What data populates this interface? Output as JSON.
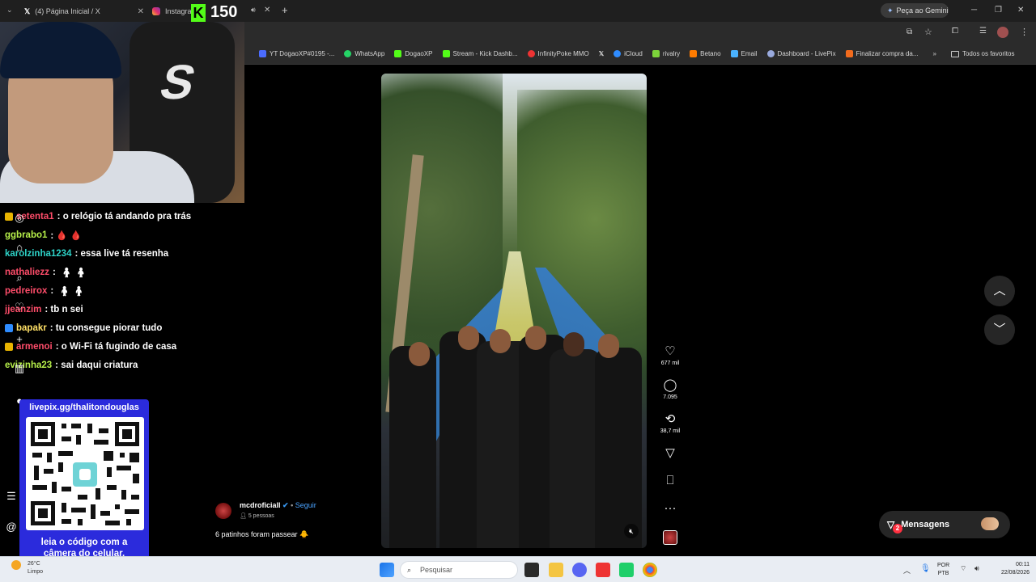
{
  "browser": {
    "tabs": [
      {
        "label": "(4) Página Inicial / X"
      },
      {
        "label": "Instagram"
      }
    ],
    "gemini_label": "Peça ao Gemini",
    "bookmarks": [
      {
        "label": "YT DogaoXP#0195 -...",
        "color": "#4b6cff"
      },
      {
        "label": "WhatsApp",
        "color": "#25d366"
      },
      {
        "label": "DogaoXP",
        "color": "#53fc18"
      },
      {
        "label": "Stream - Kick Dashb...",
        "color": "#53fc18"
      },
      {
        "label": "InfinityPoke MMO",
        "color": "#e33"
      },
      {
        "label": "",
        "color": "#888"
      },
      {
        "label": "iCloud",
        "color": "#2f8cff"
      },
      {
        "label": "rivalry",
        "color": "#7cd43a"
      },
      {
        "label": "Betano",
        "color": "#ff7b00"
      },
      {
        "label": "Email",
        "color": "#4ab3ff"
      },
      {
        "label": "Dashboard - LivePix",
        "color": "#9ad"
      },
      {
        "label": "Finalizar compra da...",
        "color": "#f26b1d"
      }
    ],
    "all_favorites": "Todos os favoritos"
  },
  "stream": {
    "viewer_count": "150",
    "chat": [
      {
        "user": "setenta1",
        "user_color": "#ff4d6a",
        "text": ": o relógio tá andando pra trás",
        "badge": "#e8b400"
      },
      {
        "user": "ggbrabo1",
        "user_color": "#b7f04a",
        "text": ": 🩸 🩸",
        "badge": ""
      },
      {
        "user": "karolzinha1234",
        "user_color": "#2ed3c8",
        "text": ": essa live tá resenha",
        "badge": ""
      },
      {
        "user": "nathaliezz",
        "user_color": "#ff4d6a",
        "text": ":",
        "badge": ""
      },
      {
        "user": "pedreirox",
        "user_color": "#ff4d6a",
        "text": ":",
        "badge": ""
      },
      {
        "user": "jjeanzim",
        "user_color": "#ff4d6a",
        "text": ": tb n sei",
        "badge": ""
      },
      {
        "user": "bapakr",
        "user_color": "#ffe066",
        "text": ": tu consegue piorar tudo",
        "badge": "#2e8cff"
      },
      {
        "user": "armenoi",
        "user_color": "#ff4d6a",
        "text": ": o Wi-Fi tá fugindo de casa",
        "badge": "#e8b400"
      },
      {
        "user": "evizinha23",
        "user_color": "#b7f04a",
        "text": ": sai daqui criatura",
        "badge": ""
      }
    ],
    "qr_url": "livepix.gg/thalitondouglas",
    "qr_caption_line1": "leia o código com a",
    "qr_caption_line2": "câmera do celular."
  },
  "reel": {
    "likes": "677 mil",
    "comments": "7.095",
    "reposts": "38,7 mil",
    "author": "mcdroficiall",
    "follow": "Seguir",
    "audience": "5 pessoas",
    "caption": "6 patinhos foram passear 🐥"
  },
  "messages": {
    "label": "Mensagens",
    "badge": "2"
  },
  "taskbar": {
    "weather_temp": "26°C",
    "weather_desc": "Limpo",
    "search_placeholder": "Pesquisar",
    "lang_top": "POR",
    "lang_bottom": "PTB",
    "time": "00:11",
    "date": "22/08/2026"
  }
}
